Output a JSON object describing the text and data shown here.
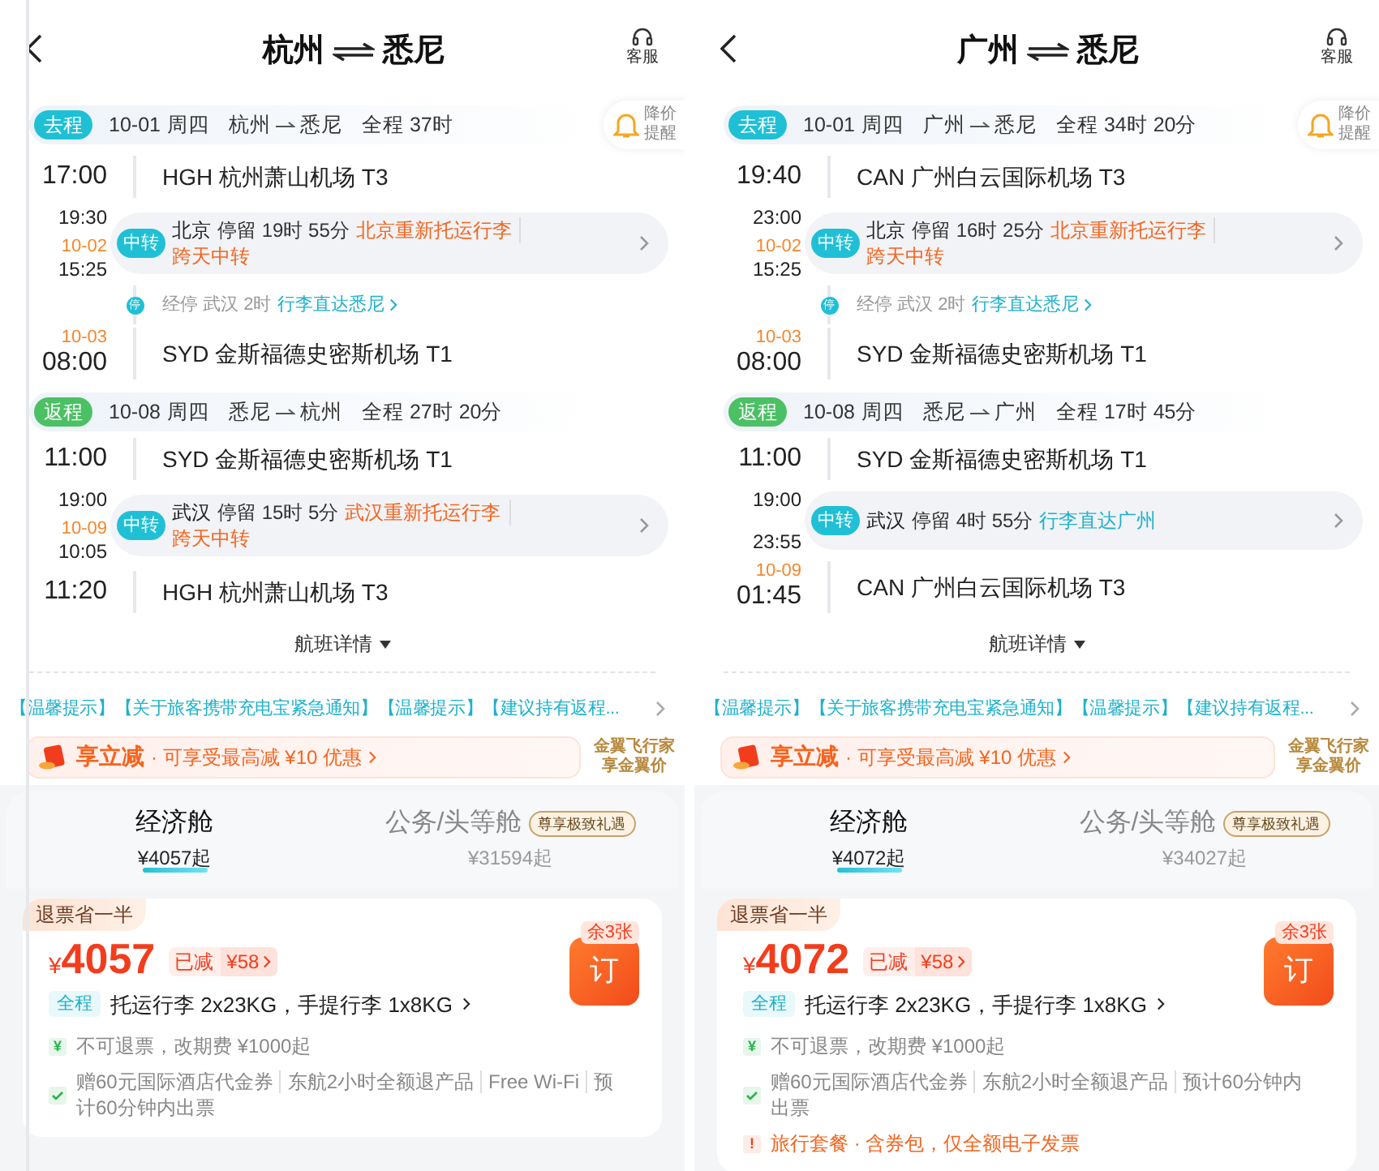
{
  "panels": [
    {
      "title_from": "杭州",
      "title_to": "悉尼",
      "service_label": "客服",
      "alert_lines": [
        "降价",
        "提醒"
      ],
      "trips": [
        {
          "kind": "outbound",
          "tag": "去程",
          "date": "10-01",
          "weekday": "周四",
          "from": "杭州",
          "to": "悉尼",
          "duration": "全程 37时",
          "rows": [
            {
              "kind": "airport",
              "time": "17:00",
              "name": "HGH 杭州萧山机场 T3"
            },
            {
              "kind": "transfer",
              "badge": "中转",
              "arrive": "19:30",
              "depart_date": "10-02",
              "depart": "15:25",
              "city": "北京",
              "stay": "停留 19时 55分",
              "notes": [
                {
                  "kind": "warn",
                  "text": "北京重新托运行李"
                }
              ],
              "extra": "跨天中转"
            },
            {
              "kind": "stop",
              "badge": "停",
              "text": "经停 武汉 2时",
              "link": "行李直达悉尼"
            },
            {
              "kind": "airport",
              "date": "10-03",
              "time": "08:00",
              "name": "SYD 金斯福德史密斯机场 T1"
            }
          ]
        },
        {
          "kind": "return",
          "tag": "返程",
          "date": "10-08",
          "weekday": "周四",
          "from": "悉尼",
          "to": "杭州",
          "duration": "全程 27时 20分",
          "rows": [
            {
              "kind": "airport",
              "time": "11:00",
              "name": "SYD 金斯福德史密斯机场 T1"
            },
            {
              "kind": "transfer",
              "badge": "中转",
              "arrive": "19:00",
              "depart_date": "10-09",
              "depart": "10:05",
              "city": "武汉",
              "stay": "停留 15时 5分",
              "notes": [
                {
                  "kind": "warn",
                  "text": "武汉重新托运行李"
                }
              ],
              "extra": "跨天中转"
            },
            {
              "kind": "airport",
              "time": "11:20",
              "name": "HGH 杭州萧山机场 T3"
            }
          ]
        }
      ],
      "details_label": "航班详情",
      "notice": "【温馨提示】【关于旅客携带充电宝紧急通知】【温馨提示】【建议持有返程...",
      "promo": {
        "title": "享立减",
        "text": "· 可享受最高减 ¥10 优惠",
        "member_lines": [
          "金翼飞行家",
          "享金翼价"
        ]
      },
      "cabins": [
        {
          "name": "经济舱",
          "price": "¥4057起",
          "selected": true
        },
        {
          "name": "公务/头等舱",
          "badge": "尊享极致礼遇",
          "price": "¥31594起",
          "selected": false
        }
      ],
      "fare": {
        "tag": "退票省一半",
        "currency": "¥",
        "price": "4057",
        "discount_label": "已减",
        "discount": "¥58",
        "stock": "余3张",
        "book_label": "订",
        "scope": "全程",
        "baggage": "托运行李 2x23KG，手提行李 1x8KG",
        "items": [
          {
            "kind": "money",
            "icon": "¥",
            "parts": [
              "不可退票，改期费 ¥1000起"
            ]
          },
          {
            "kind": "check",
            "parts": [
              "赠60元国际酒店代金券",
              "东航2小时全额退产品",
              "Free Wi-Fi",
              "预计60分钟内出票"
            ]
          }
        ]
      }
    },
    {
      "title_from": "广州",
      "title_to": "悉尼",
      "service_label": "客服",
      "alert_lines": [
        "降价",
        "提醒"
      ],
      "trips": [
        {
          "kind": "outbound",
          "tag": "去程",
          "date": "10-01",
          "weekday": "周四",
          "from": "广州",
          "to": "悉尼",
          "duration": "全程 34时 20分",
          "rows": [
            {
              "kind": "airport",
              "time": "19:40",
              "name": "CAN 广州白云国际机场 T3"
            },
            {
              "kind": "transfer",
              "badge": "中转",
              "arrive": "23:00",
              "depart_date": "10-02",
              "depart": "15:25",
              "city": "北京",
              "stay": "停留 16时 25分",
              "notes": [
                {
                  "kind": "warn",
                  "text": "北京重新托运行李"
                }
              ],
              "extra": "跨天中转"
            },
            {
              "kind": "stop",
              "badge": "停",
              "text": "经停 武汉 2时",
              "link": "行李直达悉尼"
            },
            {
              "kind": "airport",
              "date": "10-03",
              "time": "08:00",
              "name": "SYD 金斯福德史密斯机场 T1"
            }
          ]
        },
        {
          "kind": "return",
          "tag": "返程",
          "date": "10-08",
          "weekday": "周四",
          "from": "悉尼",
          "to": "广州",
          "duration": "全程 17时 45分",
          "rows": [
            {
              "kind": "airport",
              "time": "11:00",
              "name": "SYD 金斯福德史密斯机场 T1"
            },
            {
              "kind": "transfer",
              "badge": "中转",
              "arrive": "19:00",
              "depart": "23:55",
              "city": "武汉",
              "stay": "停留 4时 55分",
              "notes": [
                {
                  "kind": "info",
                  "text": "行李直达广州"
                }
              ]
            },
            {
              "kind": "airport",
              "date": "10-09",
              "time": "01:45",
              "name": "CAN 广州白云国际机场 T3"
            }
          ]
        }
      ],
      "details_label": "航班详情",
      "notice": "【温馨提示】【关于旅客携带充电宝紧急通知】【温馨提示】【建议持有返程...",
      "promo": {
        "title": "享立减",
        "text": "· 可享受最高减 ¥10 优惠",
        "member_lines": [
          "金翼飞行家",
          "享金翼价"
        ]
      },
      "cabins": [
        {
          "name": "经济舱",
          "price": "¥4072起",
          "selected": true
        },
        {
          "name": "公务/头等舱",
          "badge": "尊享极致礼遇",
          "price": "¥34027起",
          "selected": false
        }
      ],
      "fare": {
        "tag": "退票省一半",
        "currency": "¥",
        "price": "4072",
        "discount_label": "已减",
        "discount": "¥58",
        "stock": "余3张",
        "book_label": "订",
        "scope": "全程",
        "baggage": "托运行李 2x23KG，手提行李 1x8KG",
        "items": [
          {
            "kind": "money",
            "icon": "¥",
            "parts": [
              "不可退票，改期费 ¥1000起"
            ]
          },
          {
            "kind": "check",
            "parts": [
              "赠60元国际酒店代金券",
              "东航2小时全额退产品",
              "预计60分钟内出票"
            ]
          },
          {
            "kind": "warn",
            "icon": "!",
            "parts": [
              "旅行套餐 · 含券包，仅全额电子发票"
            ]
          }
        ]
      }
    }
  ]
}
